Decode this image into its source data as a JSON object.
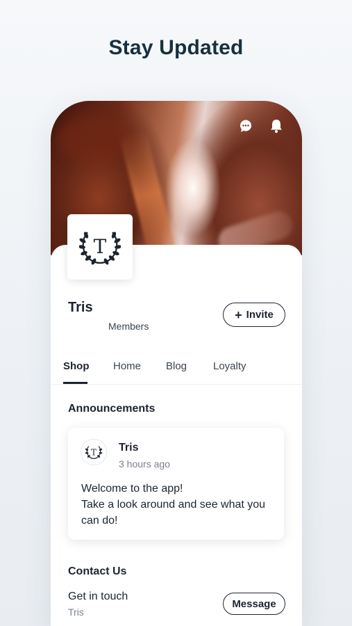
{
  "headline": "Stay Updated",
  "header": {
    "icons": [
      "chat-icon",
      "bell-icon"
    ]
  },
  "site": {
    "name": "Tris",
    "members_label": "Members",
    "invite_label": "Invite",
    "logo_letter": "T"
  },
  "tabs": [
    {
      "label": "Shop",
      "active": true
    },
    {
      "label": "Home",
      "active": false
    },
    {
      "label": "Blog",
      "active": false
    },
    {
      "label": "Loyalty",
      "active": false
    }
  ],
  "announcements": {
    "title": "Announcements",
    "post": {
      "author": "Tris",
      "time": "3 hours ago",
      "lines": [
        "Welcome to the app!",
        "Take a look around and see what you",
        "can do!"
      ]
    }
  },
  "contact": {
    "title": "Contact Us",
    "label": "Get in touch",
    "sub": "Tris",
    "button": "Message"
  },
  "colors": {
    "text": "#1c2430",
    "headline": "#17303d",
    "muted": "#7a828c"
  }
}
